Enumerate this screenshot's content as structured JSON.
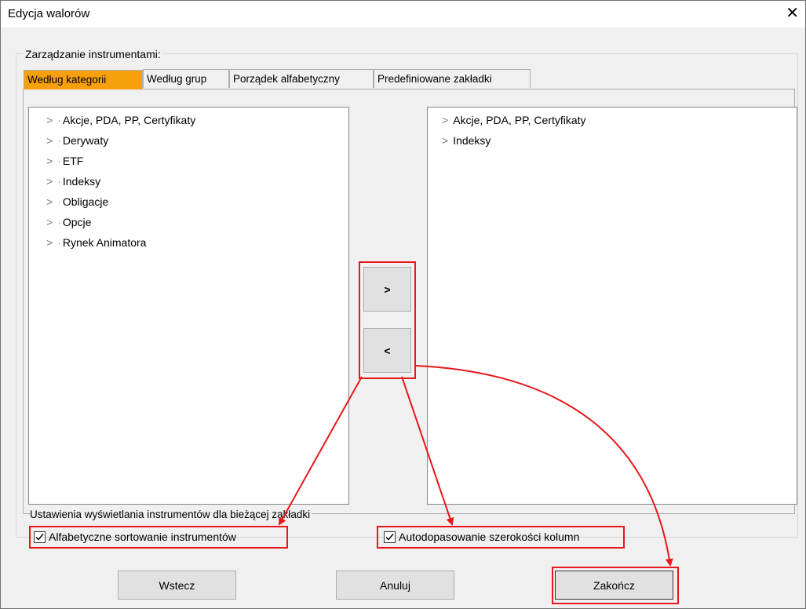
{
  "window": {
    "title": "Edycja walorów",
    "close_glyph": "✕"
  },
  "group": {
    "label": "Zarządzanie instrumentami:"
  },
  "tabs": [
    {
      "label": "Według kategorii",
      "active": true
    },
    {
      "label": "Według grup",
      "active": false
    },
    {
      "label": "Porządek alfabetyczny",
      "active": false
    },
    {
      "label": "Predefiniowane zakładki",
      "active": false
    }
  ],
  "left_list": {
    "items": [
      {
        "label": "Akcje, PDA, PP, Certyfikaty"
      },
      {
        "label": "Derywaty"
      },
      {
        "label": "ETF"
      },
      {
        "label": "Indeksy"
      },
      {
        "label": "Obligacje"
      },
      {
        "label": "Opcje"
      },
      {
        "label": "Rynek Animatora"
      }
    ]
  },
  "right_list": {
    "items": [
      {
        "label": "Akcje, PDA, PP, Certyfikaty"
      },
      {
        "label": "Indeksy"
      }
    ]
  },
  "move_buttons": {
    "add": ">",
    "remove": "<"
  },
  "settings": {
    "label": "Ustawienia wyświetlania instrumentów dla bieżącej zakładki",
    "alpha_sort": {
      "label": "Alfabetyczne sortowanie instrumentów",
      "checked": true
    },
    "autofit": {
      "label": "Autodopasowanie szerokości kolumn",
      "checked": true
    }
  },
  "footer": {
    "back": "Wstecz",
    "cancel": "Anuluj",
    "finish": "Zakończ"
  },
  "colors": {
    "active_tab": "#f6a00b",
    "annotation": "#e8171b"
  }
}
